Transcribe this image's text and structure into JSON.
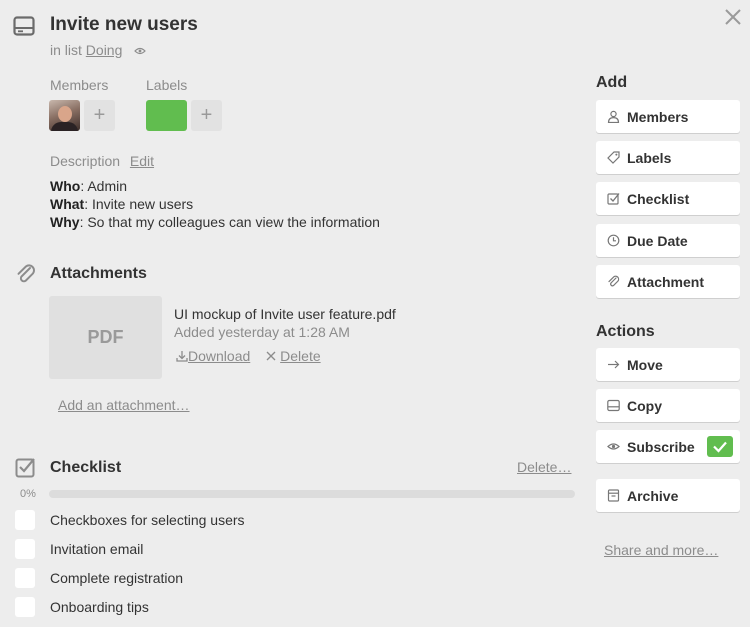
{
  "header": {
    "title": "Invite new users",
    "in_list_prefix": "in list",
    "list_name": "Doing"
  },
  "members_label": "Members",
  "labels_label": "Labels",
  "label_color": "#61bd4f",
  "description": {
    "heading": "Description",
    "edit": "Edit",
    "lines": [
      {
        "key": "Who",
        "value": ": Admin"
      },
      {
        "key": "What",
        "value": ": Invite new users"
      },
      {
        "key": "Why",
        "value": ": So that my colleagues can view the information"
      }
    ]
  },
  "attachments": {
    "title": "Attachments",
    "file": {
      "thumb": "PDF",
      "name": "UI mockup of Invite user feature.pdf",
      "added": "Added yesterday at 1:28 AM",
      "download": "Download",
      "delete": "Delete"
    },
    "add_link": "Add an attachment…"
  },
  "checklist": {
    "title": "Checklist",
    "delete": "Delete…",
    "percent_label": "0%",
    "progress": 0,
    "items": [
      {
        "text": "Checkboxes for selecting users",
        "checked": false
      },
      {
        "text": "Invitation email",
        "checked": false
      },
      {
        "text": "Complete registration",
        "checked": false
      },
      {
        "text": "Onboarding tips",
        "checked": false
      }
    ]
  },
  "sidebar": {
    "add_title": "Add",
    "add_buttons": [
      {
        "label": "Members",
        "icon": "person-icon"
      },
      {
        "label": "Labels",
        "icon": "tag-icon"
      },
      {
        "label": "Checklist",
        "icon": "checkbox-icon"
      },
      {
        "label": "Due Date",
        "icon": "clock-icon"
      },
      {
        "label": "Attachment",
        "icon": "paperclip-icon"
      }
    ],
    "actions_title": "Actions",
    "action_buttons": [
      {
        "label": "Move",
        "icon": "arrow-right-icon"
      },
      {
        "label": "Copy",
        "icon": "card-icon"
      },
      {
        "label": "Subscribe",
        "icon": "eye-icon",
        "subscribed": true
      },
      {
        "label": "Archive",
        "icon": "archive-icon"
      }
    ],
    "share_link": "Share and more…"
  }
}
